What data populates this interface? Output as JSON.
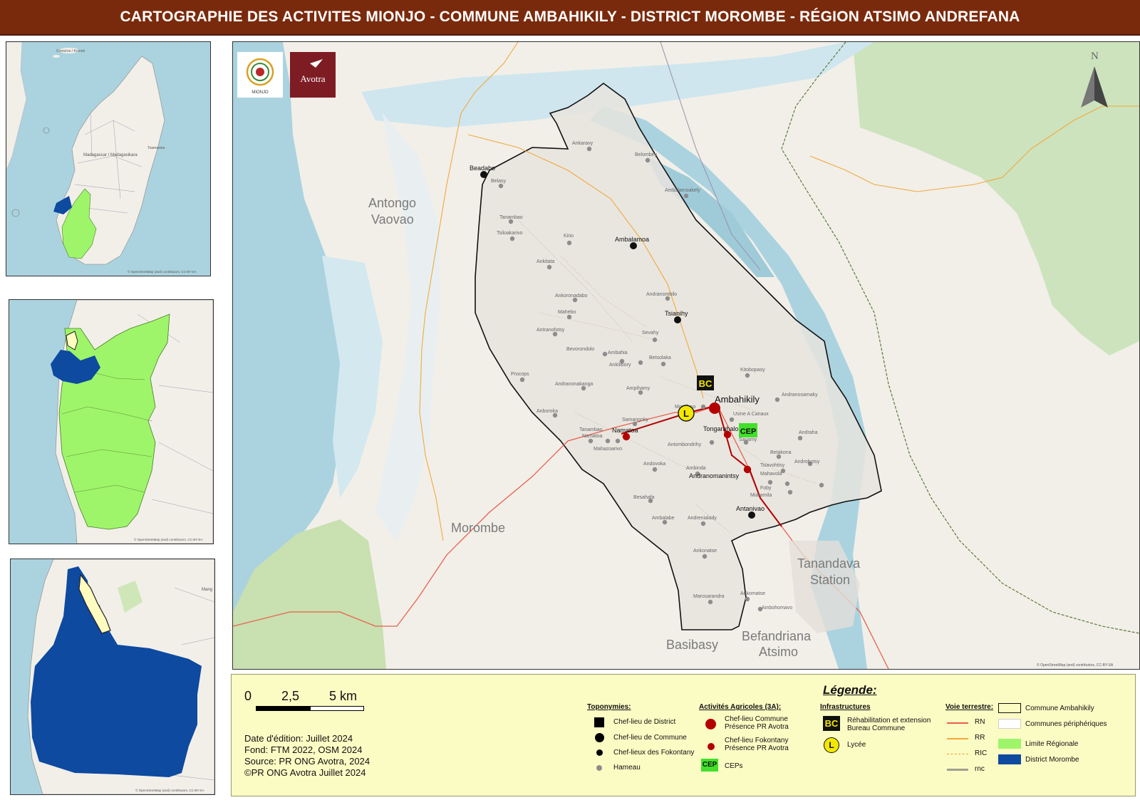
{
  "title": "CARTOGRAPHIE DES ACTIVITES MIONJO -  COMMUNE AMBAHIKILY - DISTRICT MOROMBE - RÉGION ATSIMO ANDREFANA",
  "attribution": "© OpenStreetMap (and) contributors, CC-BY-SA",
  "north_label": "N",
  "logos": {
    "mionjo": "MIONJO",
    "avotra": "Avotra"
  },
  "inset1_labels": {
    "comores": "Comoros / Komori",
    "madagascar": "Madagascar / Madagasikara",
    "toamasina": "Toamasina"
  },
  "region_labels": {
    "antongo": "Antongo Vaovao",
    "morombe": "Morombe",
    "tanandava": "Tanandava Station",
    "basibasy": "Basibasy",
    "befandriana": "Befandriana Atsimo"
  },
  "places": {
    "beadabo": "Beadabo",
    "ambalamoa": "Ambalamoa",
    "tsianihy": "Tsianihy",
    "ambahikily": "Ambahikily",
    "namatoa": "Namatoa",
    "tongarahaloka": "Tongarahaloka",
    "andranomanintsy": "Andranomanintsy",
    "antanivao": "Antanivao",
    "ankaravy": "Ankaravy",
    "belombiry": "Belombiry",
    "belasy": "Belasy",
    "ambalamoakely": "Ambalamoakely",
    "tanambao": "Tanambao",
    "tsiloakarivo": "Tsiloakarivo",
    "kirio": "Kirio",
    "ankitata": "Ankitata",
    "andranombilo": "Andranombilo",
    "ankoronadabo": "Ankoronadabo",
    "mahebo": "Mahebo",
    "antranofotsy": "Antranofotsy",
    "sevahy": "Sevahy",
    "bevorondolo": "Bevorondolo",
    "ambahia": "Ambahia",
    "ankilibory": "Ankilibory",
    "betsolaka": "Betsolaka",
    "kitobopasy": "Kitobopasy",
    "procops": "Procops",
    "andranonakanga": "Andranonakanga",
    "ampihamy": "Ampihamy",
    "andranosamaky": "Andranosamaky",
    "anboroka": "Anboroka",
    "morafeno": "Morafeno",
    "usine_a_canaux": "Usine A Canaux",
    "samangoky": "Samangoky",
    "tanambao2": "Tanambao",
    "namatoa2": "Namatoa",
    "mahazoarivo": "Mahazoarivo",
    "antombondrihy": "Antombondrihy",
    "savamy": "Savamy",
    "andraha": "Andraha",
    "betakona": "Betakona",
    "androbotsy": "Androbotsy",
    "andovoka": "Andovoka",
    "ambinda": "Ambinda",
    "tsiavohitsy": "Tsiavohitsy",
    "mahavola": "Mahavola",
    "foby": "Foby",
    "miaramila": "Miaramila",
    "besahafa": "Besahafa",
    "ambalabe": "Ambalabe",
    "andrenialady": "Andrenialady",
    "ankonatse": "Ankonatse",
    "marosarandra": "Marosarandra",
    "ankomatse": "Ankomatse",
    "ambohomavo": "Ambohomavo"
  },
  "scale_bar": {
    "t0": "0",
    "t1": "2,5",
    "t2": "5 km"
  },
  "metadata": [
    "Date d'édition: Juillet 2024",
    "Fond: FTM 2022, OSM 2024",
    "Source: PR ONG Avotra, 2024",
    "©PR ONG Avotra Juillet 2024"
  ],
  "legend": {
    "title": "Légende:",
    "toponymies": {
      "heading": "Toponymies:",
      "items": [
        "Chef-lieu de District",
        "Chef-lieu de Commune",
        "Chef-lieux des Fokontany",
        "Hameau"
      ]
    },
    "activites": {
      "heading": "Activités Agricoles (3A):",
      "items": [
        {
          "line1": "Chef-lieu Commune",
          "line2": "Présence PR Avotra"
        },
        {
          "line1": "Chef-lieu Fokontany",
          "line2": "Présence PR Avotra"
        },
        {
          "line1": "CEPs",
          "line2": ""
        }
      ]
    },
    "infrastructures": {
      "heading": "Infrastructures",
      "items": [
        {
          "line1": "Réhabilitation et extension",
          "line2": "Bureau Commune"
        },
        {
          "line1": "Lycée",
          "line2": ""
        }
      ]
    },
    "voie": {
      "heading": "Voie terrestre:",
      "items": [
        "RN",
        "RR",
        "RIC",
        "rnc"
      ]
    },
    "zones": {
      "items": [
        "Commune Ambahikily",
        "Communes périphériques",
        "Limite Régionale",
        "District Morombe"
      ]
    },
    "symbols": {
      "bc": "BC",
      "l": "L",
      "cep": "CEP"
    }
  },
  "colors": {
    "title_bg": "#7a2a0c",
    "water": "#aad3df",
    "land": "#f2efe9",
    "region_green": "#9ef56a",
    "district_blue": "#0d4aa0",
    "commune_fill": "#fffcc0",
    "presence_red": "#b30000",
    "rn_red": "#e8604c",
    "rr_orange": "#f2a93b",
    "legend_bg": "#fbfbc4"
  }
}
